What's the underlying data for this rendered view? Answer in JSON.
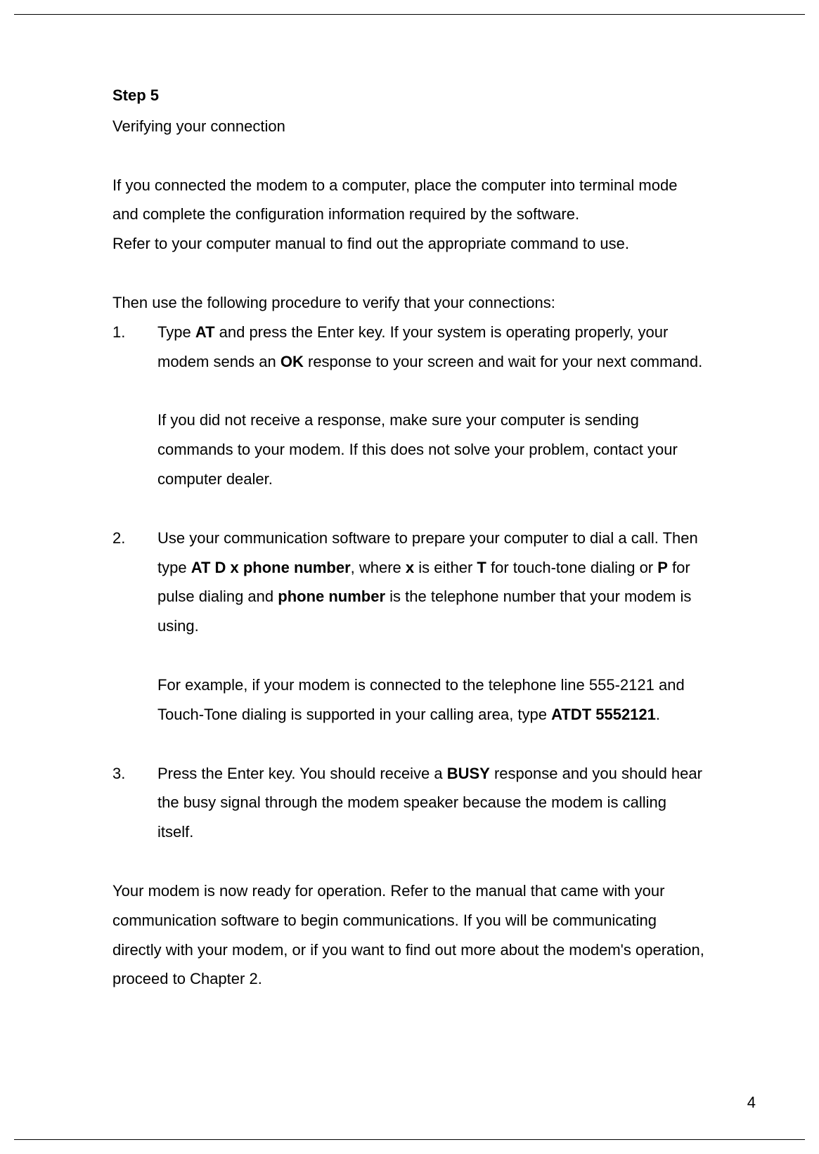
{
  "step": {
    "title": "Step 5",
    "subtitle": "Verifying your connection"
  },
  "intro": {
    "p1a": "If you connected the modem to a computer, place the computer into terminal mode and complete the configuration information required by the software.",
    "p1b": "Refer to your computer manual to find out the appropriate command to use.",
    "p2": "Then use the following procedure to verify that your connections:"
  },
  "list": {
    "item1": {
      "num": "1.",
      "t1": "Type ",
      "b1": "AT",
      "t2": " and press the Enter key. If your system is operating properly, your modem sends an ",
      "b2": "OK",
      "t3": " response to your screen and wait for your next command.",
      "sub": "If you did not receive a response, make sure your computer is sending commands to your modem. If this does not solve your problem, contact your computer dealer."
    },
    "item2": {
      "num": "2.",
      "t1": "Use your communication software to prepare your computer to dial a call. Then type ",
      "b1": "AT D x phone number",
      "t2": ", where ",
      "b2": "x",
      "t3": " is either ",
      "b3": "T",
      "t4": " for touch-tone dialing or ",
      "b4": "P",
      "t5": " for pulse dialing and ",
      "b5": "phone number",
      "t6": " is the telephone number that your modem is using.",
      "sub_t1": "For example, if your modem is connected to the telephone line 555-2121 and Touch-Tone dialing is supported in your calling area, type ",
      "sub_b1": "ATDT 5552121",
      "sub_t2": "."
    },
    "item3": {
      "num": "3.",
      "t1": "Press the Enter key. You should receive a ",
      "b1": "BUSY",
      "t2": " response and you should hear the busy signal through the modem speaker because the modem is calling itself."
    }
  },
  "closing": "Your modem is now ready for operation. Refer to the manual that came with your communication software to begin communications. If you will be communicating directly with your modem, or if you want to find out more about the modem's operation, proceed to Chapter 2.",
  "pageNumber": "4"
}
